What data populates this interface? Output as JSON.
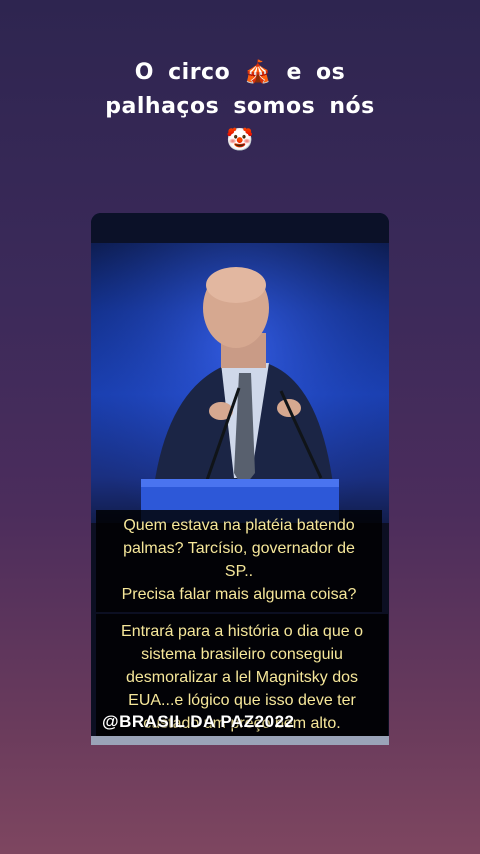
{
  "caption": {
    "line1": "O  circo",
    "line1_end": "e  os",
    "line2": "palhaços  somos  nós",
    "circus_emoji": "🎪",
    "clown_emoji": "🤡"
  },
  "subtitle1": {
    "line1": "Quem estava na platéia batendo",
    "line2": "palmas? Tarcísio, governador de",
    "line3": "SP..",
    "line4": "Precisa falar mais alguma coisa?"
  },
  "subtitle2": {
    "line1": "Entrará para a história o dia que o",
    "line2": "sistema brasileiro conseguiu",
    "line3": "desmoralizar a lel Magnitsky dos",
    "line4": "EUA...e lógico que isso deve ter",
    "line5": "custado um preço bem alto."
  },
  "watermark": "@BRASIL  DA  PAZ2022",
  "colors": {
    "subtitle_text": "#f6e79a",
    "stage_blue": "#1a3fb0"
  }
}
